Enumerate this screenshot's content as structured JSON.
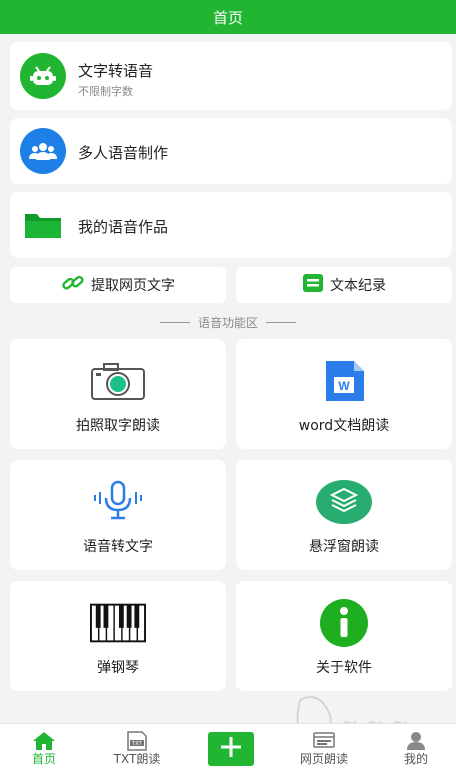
{
  "topbar": {
    "title": "首页"
  },
  "cards": [
    {
      "title": "文字转语音",
      "sub": "不限制字数",
      "icon": "android-robot-icon"
    },
    {
      "title": "多人语音制作",
      "icon": "group-people-icon"
    },
    {
      "title": "我的语音作品",
      "icon": "folder-icon"
    }
  ],
  "quick_actions": [
    {
      "label": "提取网页文字",
      "icon": "link-icon"
    },
    {
      "label": "文本纪录",
      "icon": "text-record-icon"
    }
  ],
  "section": {
    "title": "语音功能区"
  },
  "tiles": [
    {
      "label": "拍照取字朗读",
      "icon": "camera-icon"
    },
    {
      "label": "word文档朗读",
      "icon": "word-document-icon"
    },
    {
      "label": "语音转文字",
      "icon": "microphone-icon"
    },
    {
      "label": "悬浮窗朗读",
      "icon": "layers-icon"
    },
    {
      "label": "弹钢琴",
      "icon": "piano-icon"
    },
    {
      "label": "关于软件",
      "icon": "info-icon"
    }
  ],
  "bottom_nav": [
    {
      "label": "首页",
      "icon": "home-icon",
      "active": true
    },
    {
      "label": "TXT朗读",
      "icon": "txt-file-icon",
      "active": false
    },
    {
      "label": "",
      "icon": "plus-icon",
      "active": false
    },
    {
      "label": "网页朗读",
      "icon": "web-page-icon",
      "active": false
    },
    {
      "label": "我的",
      "icon": "user-icon",
      "active": false
    }
  ],
  "colors": {
    "primary": "#22b532",
    "blue": "#1e7fe6",
    "background": "#f3f3f3"
  }
}
